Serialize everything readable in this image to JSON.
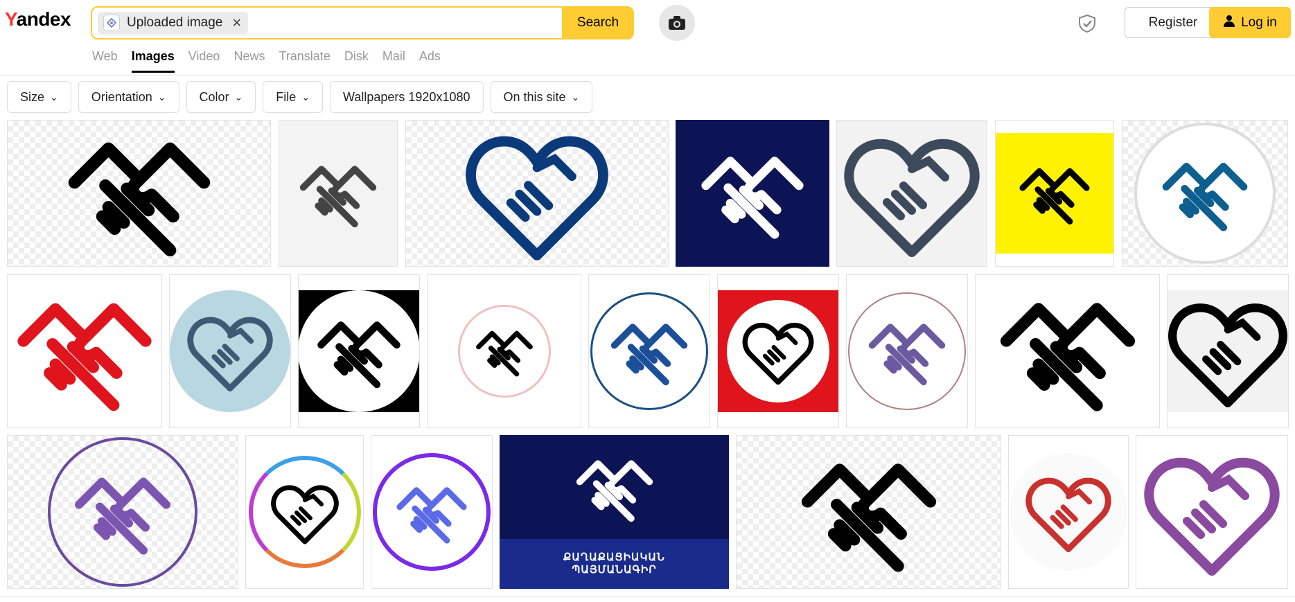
{
  "header": {
    "logo_first": "Y",
    "logo_rest": "andex",
    "search_chip_label": "Uploaded image",
    "search_chip_close": "×",
    "search_button": "Search",
    "register_label": "Register",
    "login_label": "Log in"
  },
  "tabs": [
    {
      "label": "Web",
      "active": false
    },
    {
      "label": "Images",
      "active": true
    },
    {
      "label": "Video",
      "active": false
    },
    {
      "label": "News",
      "active": false
    },
    {
      "label": "Translate",
      "active": false
    },
    {
      "label": "Disk",
      "active": false
    },
    {
      "label": "Mail",
      "active": false
    },
    {
      "label": "Ads",
      "active": false
    }
  ],
  "filters": [
    {
      "label": "Size",
      "has_dropdown": true
    },
    {
      "label": "Orientation",
      "has_dropdown": true
    },
    {
      "label": "Color",
      "has_dropdown": true
    },
    {
      "label": "File",
      "has_dropdown": true
    },
    {
      "label": "Wallpapers 1920x1080",
      "has_dropdown": false
    },
    {
      "label": "On this site",
      "has_dropdown": true
    }
  ],
  "results": {
    "banner_caption": "ՔԱՂԱՔԱՑԻԱԿԱՆ\nՊԱՅՄԱՆԱԳԻՐ"
  },
  "colors": {
    "accent_yellow": "#ffcc33",
    "logo_red": "#ff3333",
    "navy": "#0d1b4f",
    "dark_blue": "#0b3a7a",
    "red": "#e0141c",
    "purple": "#6b4a9e"
  },
  "icons": [
    "camera-icon",
    "shield-check-icon",
    "user-icon",
    "chevron-down-icon",
    "close-icon",
    "uploaded-image-thumb-icon"
  ]
}
